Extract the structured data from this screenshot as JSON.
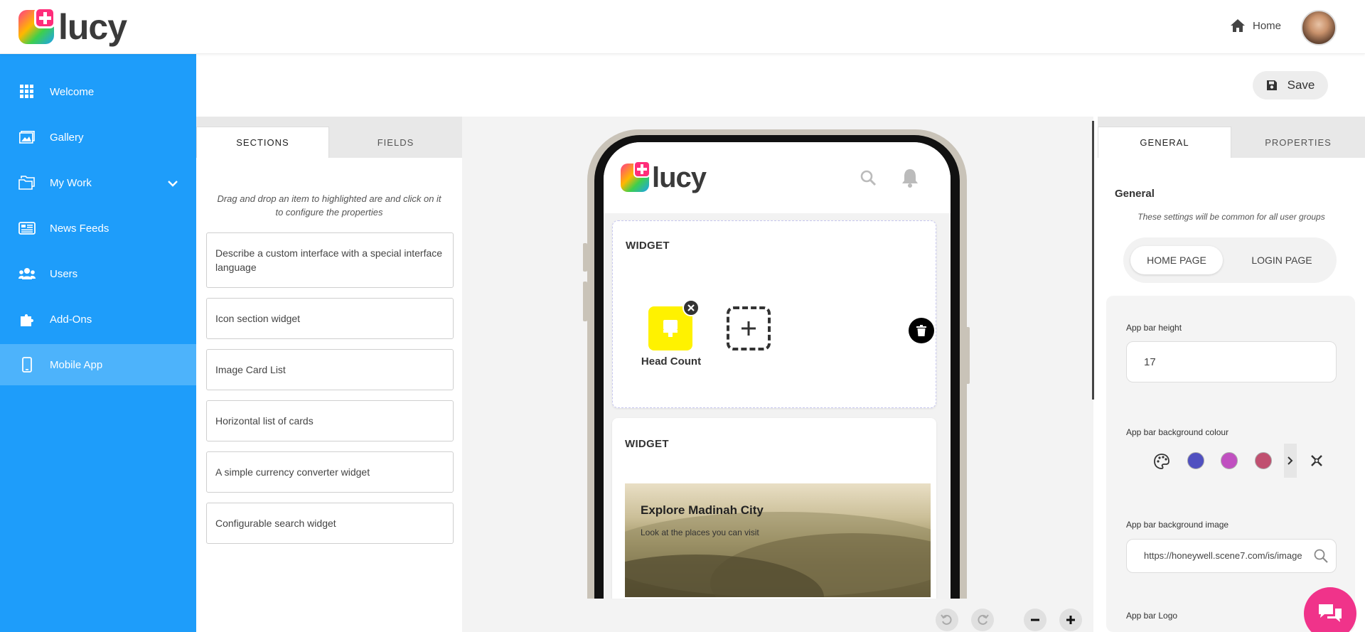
{
  "header": {
    "logo_text": "lucy",
    "home_label": "Home"
  },
  "sidebar": {
    "items": [
      {
        "label": "Welcome",
        "icon": "grid-icon"
      },
      {
        "label": "Gallery",
        "icon": "gallery-icon"
      },
      {
        "label": "My Work",
        "icon": "folder-icon"
      },
      {
        "label": "News Feeds",
        "icon": "newspaper-icon"
      },
      {
        "label": "Users",
        "icon": "users-icon"
      },
      {
        "label": "Add-Ons",
        "icon": "puzzle-icon"
      },
      {
        "label": "Mobile App",
        "icon": "mobile-icon"
      }
    ],
    "active": "Mobile App"
  },
  "toolbar": {
    "save_label": "Save"
  },
  "left_panel": {
    "tabs": [
      "SECTIONS",
      "FIELDS"
    ],
    "active_tab": "SECTIONS",
    "hint": "Drag and drop an item to highlighted are and click on it to configure the properties",
    "widgets": [
      "Describe a custom interface with a special interface language",
      "Icon section widget",
      "Image Card List",
      "Horizontal list of cards",
      "A simple currency converter widget",
      "Configurable search widget"
    ]
  },
  "phone": {
    "app_logo_text": "lucy",
    "widget1": {
      "title": "WIDGET",
      "tile_label": "Head Count"
    },
    "widget2": {
      "title": "WIDGET",
      "card_title": "Explore Madinah City",
      "card_subtitle": "Look at the places you can visit"
    }
  },
  "right_panel": {
    "tabs": [
      "GENERAL",
      "PROPERTIES"
    ],
    "active_tab": "GENERAL",
    "section_title": "General",
    "section_subtitle": "These settings will be common for all user groups",
    "page_toggle": [
      "HOME PAGE",
      "LOGIN PAGE"
    ],
    "active_page": "HOME PAGE",
    "app_bar_height_label": "App bar height",
    "app_bar_height_value": "17",
    "bg_colour_label": "App bar background colour",
    "swatches": [
      "#5050c0",
      "#c050c0",
      "#c05070"
    ],
    "bg_image_label": "App bar background image",
    "bg_image_value": "https://honeywell.scene7.com/is/image",
    "logo_label": "App bar Logo"
  },
  "colors": {
    "sidebar": "#1e9dfa",
    "sidebar_active": "#4db3fb",
    "tile_yellow": "#fff200",
    "chat_pink": "#f0338a"
  }
}
